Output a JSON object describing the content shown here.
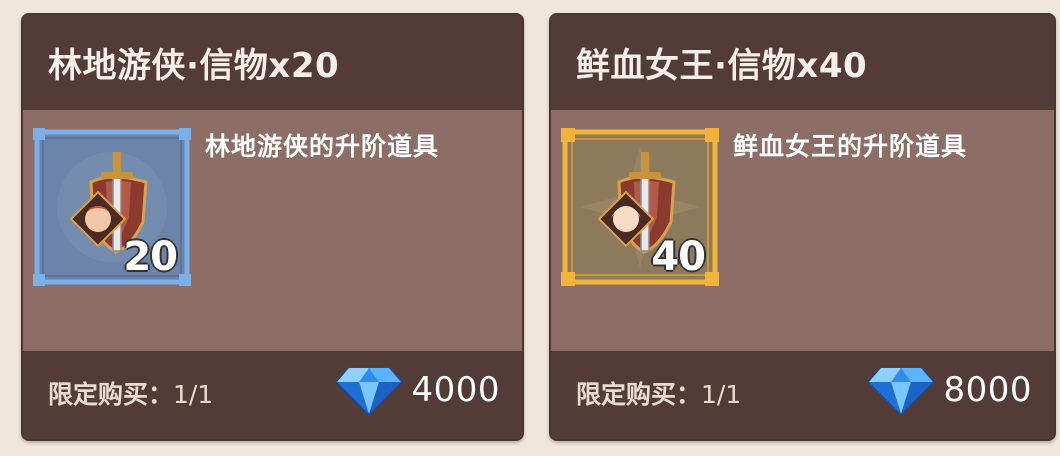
{
  "cards": [
    {
      "title": "林地游侠·信物x20",
      "description": "林地游侠的升阶道具",
      "quantity": "20",
      "frame_color": "#7ab0e8",
      "frame_inner": "#6b84a8",
      "limit_label": "限定购买：",
      "limit_count": "1/1",
      "price": "4000",
      "icon": "ranger-token-icon"
    },
    {
      "title": "鲜血女王·信物x40",
      "description": "鲜血女王的升阶道具",
      "quantity": "40",
      "frame_color": "#f2b33a",
      "frame_inner": "#8d7a5c",
      "limit_label": "限定购买：",
      "limit_count": "1/1",
      "price": "8000",
      "icon": "blood-queen-token-icon"
    }
  ],
  "currency_icon": "diamond-icon"
}
